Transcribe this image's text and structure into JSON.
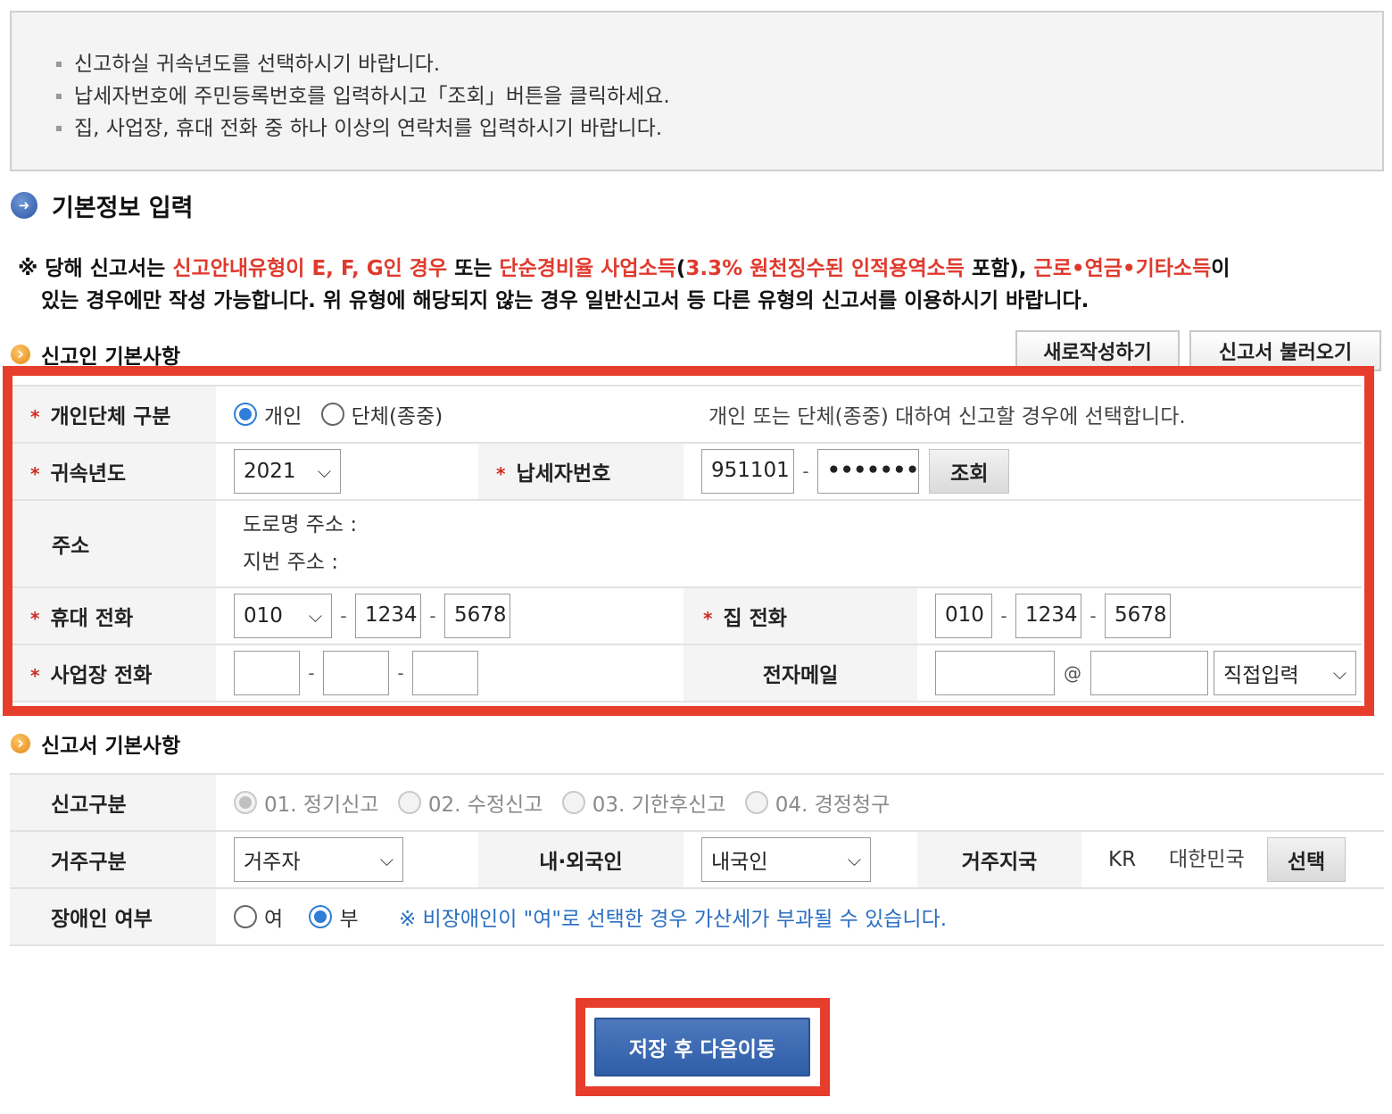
{
  "notice": {
    "lines": [
      "신고하실 귀속년도를 선택하시기 바랍니다.",
      "납세자번호에 주민등록번호를 입력하시고「조회」버튼을 클릭하세요.",
      "집, 사업장, 휴대 전화 중 하나 이상의 연락처를 입력하시기 바랍니다."
    ]
  },
  "section_title": "기본정보 입력",
  "warning": {
    "p1": "※ 당해 신고서는 ",
    "r1": "신고안내유형이 E, F, G인 경우",
    "p2": " 또는 ",
    "r2": "단순경비율 사업소득",
    "p3": "(",
    "r3": "3.3% 원천징수된 인적용역소득",
    "p4": " 포함), ",
    "r4": "근로•연금•기타소득",
    "p5": "이",
    "line2": "있는 경우에만 작성 가능합니다. 위 유형에 해당되지 않는 경우 일반신고서 등 다른 유형의 신고서를 이용하시기 바랍니다."
  },
  "filer": {
    "title": "신고인 기본사항",
    "new_button": "새로작성하기",
    "load_button": "신고서 불러오기",
    "type_label": "개인단체 구분",
    "type_opt_individual": "개인",
    "type_opt_group": "단체(종중)",
    "type_desc": "개인 또는 단체(종중) 대하여 신고할 경우에 선택합니다.",
    "year_label": "귀속년도",
    "year_value": "2021",
    "taxid_label": "납세자번호",
    "taxid_front": "951101",
    "taxid_back": "•••••••",
    "lookup_button": "조회",
    "address_label": "주소",
    "road_address": "도로명 주소 :",
    "lot_address": "지번 주소 :",
    "mobile_label": "휴대 전화",
    "mobile_1": "010",
    "mobile_2": "1234",
    "mobile_3": "5678",
    "home_label": "집 전화",
    "home_1": "010",
    "home_2": "1234",
    "home_3": "5678",
    "biz_label": "사업장 전화",
    "biz_1": "",
    "biz_2": "",
    "biz_3": "",
    "email_label": "전자메일",
    "email_id": "",
    "email_at": "@",
    "email_domain": "",
    "email_select": "직접입력",
    "required_mark": "*"
  },
  "report": {
    "title": "신고서 기본사항",
    "kind_label": "신고구분",
    "kind_opt1": "01. 정기신고",
    "kind_opt2": "02. 수정신고",
    "kind_opt3": "03. 기한후신고",
    "kind_opt4": "04. 경정청구",
    "residence_label": "거주구분",
    "residence_value": "거주자",
    "nationality_label": "내·외국인",
    "nationality_value": "내국인",
    "country_label": "거주지국",
    "country_code": "KR",
    "country_name": "대한민국",
    "country_button": "선택",
    "disabled_label": "장애인 여부",
    "disabled_yes": "여",
    "disabled_no": "부",
    "disabled_note": "※ 비장애인이 \"여\"로 선택한 경우 가산세가 부과될 수 있습니다."
  },
  "save_button": "저장 후 다음이동",
  "colors": {
    "accent_red": "#e63d2c",
    "primary_blue": "#2f5ea8",
    "note_blue": "#2a6fc2"
  }
}
